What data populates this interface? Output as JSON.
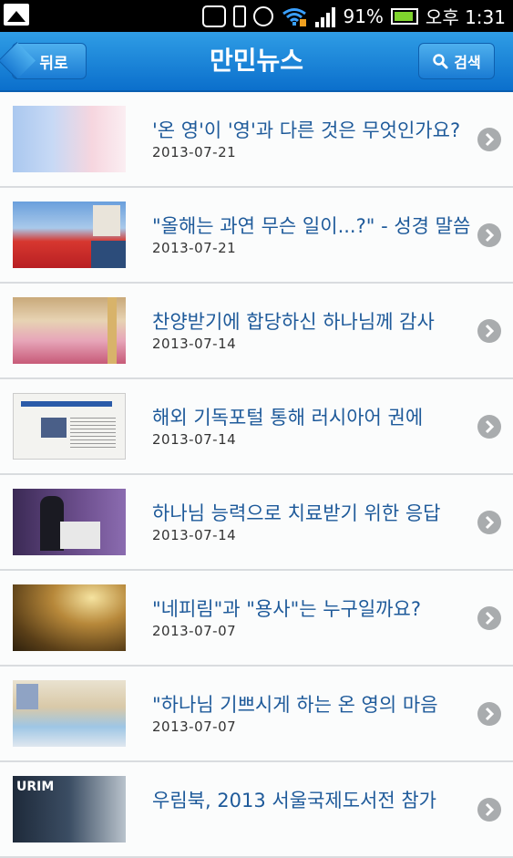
{
  "status_bar": {
    "battery": "91%",
    "time": "오후 1:31"
  },
  "header": {
    "back_label": "뒤로",
    "title": "만민뉴스",
    "search_label": "검색"
  },
  "articles": [
    {
      "title": "'온 영'이 '영'과 다른 것은 무엇인가요?",
      "date": "2013-07-21"
    },
    {
      "title": "\"올해는 과연 무슨 일이...?\" - 성경 말씀",
      "date": "2013-07-21"
    },
    {
      "title": "찬양받기에 합당하신 하나님께 감사",
      "date": "2013-07-14"
    },
    {
      "title": "해외 기독포털 통해 러시아어 권에",
      "date": "2013-07-14"
    },
    {
      "title": "하나님 능력으로 치료받기 위한 응답",
      "date": "2013-07-14"
    },
    {
      "title": "\"네피림\"과 \"용사\"는 누구일까요?",
      "date": "2013-07-07"
    },
    {
      "title": "\"하나님 기쁘시게 하는 온 영의 마음",
      "date": "2013-07-07"
    },
    {
      "title": "우림북, 2013 서울국제도서전 참가",
      "date": ""
    }
  ]
}
